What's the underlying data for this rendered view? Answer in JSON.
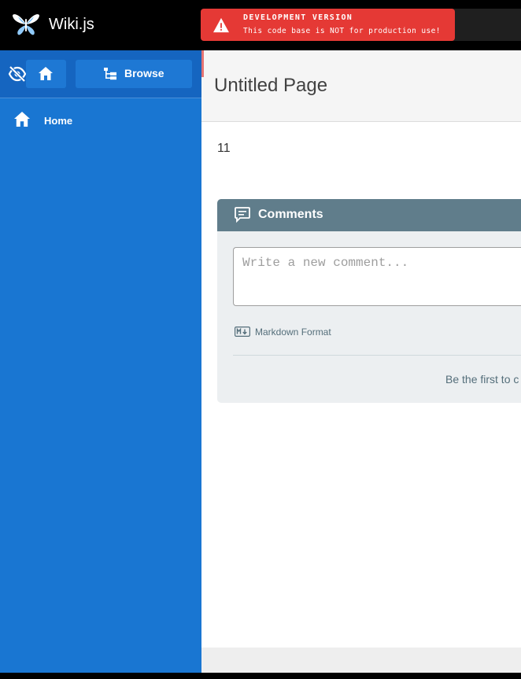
{
  "app": {
    "brand": "Wiki.js"
  },
  "dev_banner": {
    "title": "DEVELOPMENT VERSION",
    "message": "This code base is NOT for production use!",
    "icon": "warning-icon",
    "color": "#e53935"
  },
  "sidebar": {
    "browse_label": "Browse",
    "items": [
      {
        "label": "Home",
        "icon": "home-icon"
      }
    ],
    "color": "#1976d2"
  },
  "page": {
    "title": "Untitled Page",
    "content": "11"
  },
  "comments": {
    "title": "Comments",
    "placeholder": "Write a new comment...",
    "markdown_label": "Markdown Format",
    "empty_text": "Be the first to c",
    "header_color": "#607d8b"
  }
}
